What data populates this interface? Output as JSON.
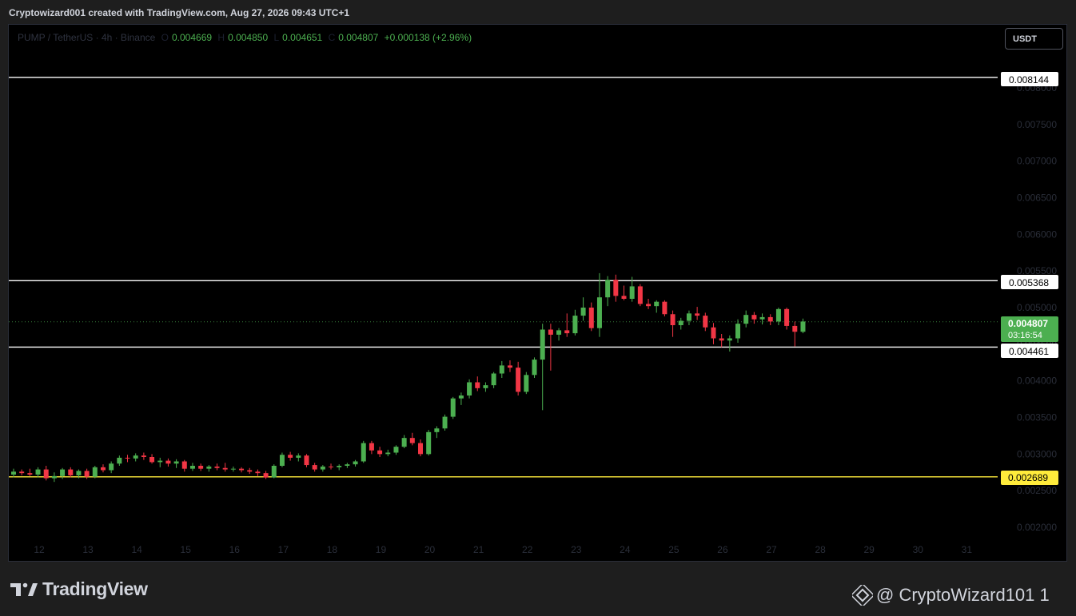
{
  "header": {
    "credit": "Cryptowizard001 created with TradingView.com, Aug 27, 2026 09:43 UTC+1"
  },
  "legend": {
    "symbol": "PUMP / TetherUS · 4h · Binance",
    "open": "0.004669",
    "high": "0.004850",
    "low": "0.004651",
    "close": "0.004807",
    "change": "+0.000138 (+2.96%)"
  },
  "currency_button": "USDT",
  "price_tags": {
    "resistance_top": "0.008144",
    "resistance_mid": "0.005368",
    "current_price": "0.004807",
    "countdown": "03:16:54",
    "support_mid": "0.004461",
    "support_low": "0.002689"
  },
  "footer": {
    "brand": "TradingView",
    "author": "@ CryptoWizard101 1"
  },
  "colors": {
    "up": "#4caf50",
    "down": "#f23645",
    "level_line": "#ffffff",
    "support_line": "#ffeb3b",
    "axis_text": "#2a2e39",
    "background": "#000000"
  },
  "chart_data": {
    "type": "candlestick",
    "title": "PUMP / TetherUS · 4h · Binance",
    "xlabel": "",
    "ylabel": "",
    "x_tick_labels": [
      "12",
      "13",
      "14",
      "15",
      "16",
      "17",
      "18",
      "19",
      "20",
      "21",
      "22",
      "23",
      "24",
      "25",
      "26",
      "27",
      "28",
      "29",
      "30",
      "31"
    ],
    "y_tick_labels": [
      "0.008000",
      "0.007500",
      "0.007000",
      "0.006500",
      "0.006000",
      "0.005500",
      "0.005000",
      "0.004500",
      "0.004000",
      "0.003500",
      "0.003000",
      "0.002500",
      "0.002000"
    ],
    "ylim": [
      0.00185,
      0.0088
    ],
    "horizontal_levels": [
      0.008144,
      0.005368,
      0.004461,
      0.002689
    ],
    "last_price": 0.004807,
    "grid": false,
    "candles": [
      {
        "o": 0.00272,
        "h": 0.0028,
        "l": 0.00268,
        "c": 0.00276
      },
      {
        "o": 0.00276,
        "h": 0.00279,
        "l": 0.00271,
        "c": 0.00274
      },
      {
        "o": 0.00274,
        "h": 0.0028,
        "l": 0.0027,
        "c": 0.00272
      },
      {
        "o": 0.00272,
        "h": 0.00282,
        "l": 0.00268,
        "c": 0.00279
      },
      {
        "o": 0.00279,
        "h": 0.00284,
        "l": 0.00264,
        "c": 0.00267
      },
      {
        "o": 0.00267,
        "h": 0.00275,
        "l": 0.00262,
        "c": 0.0027
      },
      {
        "o": 0.0027,
        "h": 0.00281,
        "l": 0.00266,
        "c": 0.00279
      },
      {
        "o": 0.00279,
        "h": 0.00282,
        "l": 0.00268,
        "c": 0.00271
      },
      {
        "o": 0.00271,
        "h": 0.00279,
        "l": 0.00267,
        "c": 0.00277
      },
      {
        "o": 0.00277,
        "h": 0.0028,
        "l": 0.00266,
        "c": 0.00269
      },
      {
        "o": 0.00269,
        "h": 0.00284,
        "l": 0.00267,
        "c": 0.00282
      },
      {
        "o": 0.00282,
        "h": 0.00286,
        "l": 0.00275,
        "c": 0.00278
      },
      {
        "o": 0.00278,
        "h": 0.0029,
        "l": 0.00274,
        "c": 0.00287
      },
      {
        "o": 0.00287,
        "h": 0.00298,
        "l": 0.00284,
        "c": 0.00295
      },
      {
        "o": 0.00295,
        "h": 0.00299,
        "l": 0.00289,
        "c": 0.00294
      },
      {
        "o": 0.00294,
        "h": 0.00301,
        "l": 0.0029,
        "c": 0.00298
      },
      {
        "o": 0.00298,
        "h": 0.00302,
        "l": 0.00292,
        "c": 0.00296
      },
      {
        "o": 0.00296,
        "h": 0.003,
        "l": 0.00287,
        "c": 0.00289
      },
      {
        "o": 0.00289,
        "h": 0.00295,
        "l": 0.00282,
        "c": 0.00291
      },
      {
        "o": 0.00291,
        "h": 0.00294,
        "l": 0.00283,
        "c": 0.00287
      },
      {
        "o": 0.00287,
        "h": 0.00293,
        "l": 0.00281,
        "c": 0.0029
      },
      {
        "o": 0.0029,
        "h": 0.00292,
        "l": 0.00276,
        "c": 0.0028
      },
      {
        "o": 0.0028,
        "h": 0.00288,
        "l": 0.00277,
        "c": 0.00284
      },
      {
        "o": 0.00284,
        "h": 0.00287,
        "l": 0.00277,
        "c": 0.0028
      },
      {
        "o": 0.0028,
        "h": 0.00285,
        "l": 0.00276,
        "c": 0.00283
      },
      {
        "o": 0.00283,
        "h": 0.00287,
        "l": 0.00278,
        "c": 0.00281
      },
      {
        "o": 0.00281,
        "h": 0.00288,
        "l": 0.00276,
        "c": 0.00279
      },
      {
        "o": 0.00279,
        "h": 0.00283,
        "l": 0.00276,
        "c": 0.0028
      },
      {
        "o": 0.0028,
        "h": 0.00282,
        "l": 0.00275,
        "c": 0.00278
      },
      {
        "o": 0.00278,
        "h": 0.00281,
        "l": 0.00273,
        "c": 0.00276
      },
      {
        "o": 0.00276,
        "h": 0.00279,
        "l": 0.0027,
        "c": 0.00274
      },
      {
        "o": 0.00274,
        "h": 0.00277,
        "l": 0.00266,
        "c": 0.00268
      },
      {
        "o": 0.00268,
        "h": 0.00286,
        "l": 0.00267,
        "c": 0.00284
      },
      {
        "o": 0.00284,
        "h": 0.00302,
        "l": 0.00282,
        "c": 0.00299
      },
      {
        "o": 0.00299,
        "h": 0.00303,
        "l": 0.00291,
        "c": 0.00295
      },
      {
        "o": 0.00295,
        "h": 0.00301,
        "l": 0.0029,
        "c": 0.00298
      },
      {
        "o": 0.00298,
        "h": 0.003,
        "l": 0.00282,
        "c": 0.00285
      },
      {
        "o": 0.00285,
        "h": 0.00288,
        "l": 0.00276,
        "c": 0.00279
      },
      {
        "o": 0.00279,
        "h": 0.00285,
        "l": 0.00276,
        "c": 0.00283
      },
      {
        "o": 0.00283,
        "h": 0.00287,
        "l": 0.00279,
        "c": 0.00282
      },
      {
        "o": 0.00282,
        "h": 0.00286,
        "l": 0.00278,
        "c": 0.00284
      },
      {
        "o": 0.00284,
        "h": 0.00288,
        "l": 0.00281,
        "c": 0.00286
      },
      {
        "o": 0.00286,
        "h": 0.00292,
        "l": 0.00283,
        "c": 0.0029
      },
      {
        "o": 0.0029,
        "h": 0.00318,
        "l": 0.00288,
        "c": 0.00315
      },
      {
        "o": 0.00315,
        "h": 0.00318,
        "l": 0.003,
        "c": 0.00305
      },
      {
        "o": 0.00305,
        "h": 0.0031,
        "l": 0.00296,
        "c": 0.003
      },
      {
        "o": 0.003,
        "h": 0.00306,
        "l": 0.00297,
        "c": 0.00302
      },
      {
        "o": 0.00302,
        "h": 0.00312,
        "l": 0.00299,
        "c": 0.0031
      },
      {
        "o": 0.0031,
        "h": 0.00326,
        "l": 0.00308,
        "c": 0.00322
      },
      {
        "o": 0.00322,
        "h": 0.00329,
        "l": 0.00312,
        "c": 0.00315
      },
      {
        "o": 0.00315,
        "h": 0.0032,
        "l": 0.00297,
        "c": 0.003
      },
      {
        "o": 0.003,
        "h": 0.00333,
        "l": 0.00298,
        "c": 0.0033
      },
      {
        "o": 0.0033,
        "h": 0.00338,
        "l": 0.00322,
        "c": 0.00335
      },
      {
        "o": 0.00335,
        "h": 0.00354,
        "l": 0.00332,
        "c": 0.00351
      },
      {
        "o": 0.00351,
        "h": 0.00378,
        "l": 0.00348,
        "c": 0.00376
      },
      {
        "o": 0.00376,
        "h": 0.00384,
        "l": 0.00367,
        "c": 0.0038
      },
      {
        "o": 0.0038,
        "h": 0.00402,
        "l": 0.00376,
        "c": 0.00398
      },
      {
        "o": 0.00398,
        "h": 0.00406,
        "l": 0.00386,
        "c": 0.0039
      },
      {
        "o": 0.0039,
        "h": 0.00398,
        "l": 0.00385,
        "c": 0.00394
      },
      {
        "o": 0.00394,
        "h": 0.00412,
        "l": 0.0039,
        "c": 0.0041
      },
      {
        "o": 0.0041,
        "h": 0.00427,
        "l": 0.00404,
        "c": 0.00421
      },
      {
        "o": 0.00421,
        "h": 0.00428,
        "l": 0.00412,
        "c": 0.00418
      },
      {
        "o": 0.00418,
        "h": 0.00426,
        "l": 0.0038,
        "c": 0.00385
      },
      {
        "o": 0.00385,
        "h": 0.00412,
        "l": 0.00382,
        "c": 0.00408
      },
      {
        "o": 0.00408,
        "h": 0.00432,
        "l": 0.00404,
        "c": 0.00429
      },
      {
        "o": 0.00429,
        "h": 0.00478,
        "l": 0.0036,
        "c": 0.0047
      },
      {
        "o": 0.0047,
        "h": 0.00478,
        "l": 0.00414,
        "c": 0.00463
      },
      {
        "o": 0.00463,
        "h": 0.00472,
        "l": 0.00455,
        "c": 0.00469
      },
      {
        "o": 0.00469,
        "h": 0.00492,
        "l": 0.0046,
        "c": 0.00465
      },
      {
        "o": 0.00465,
        "h": 0.00497,
        "l": 0.00462,
        "c": 0.00489
      },
      {
        "o": 0.00489,
        "h": 0.00514,
        "l": 0.00482,
        "c": 0.005
      },
      {
        "o": 0.005,
        "h": 0.00507,
        "l": 0.00468,
        "c": 0.00472
      },
      {
        "o": 0.00472,
        "h": 0.00547,
        "l": 0.0046,
        "c": 0.00514
      },
      {
        "o": 0.00514,
        "h": 0.00543,
        "l": 0.00502,
        "c": 0.00538
      },
      {
        "o": 0.00538,
        "h": 0.00545,
        "l": 0.00508,
        "c": 0.00516
      },
      {
        "o": 0.00516,
        "h": 0.0053,
        "l": 0.0051,
        "c": 0.00512
      },
      {
        "o": 0.00512,
        "h": 0.00542,
        "l": 0.00508,
        "c": 0.00529
      },
      {
        "o": 0.00529,
        "h": 0.00532,
        "l": 0.00502,
        "c": 0.00505
      },
      {
        "o": 0.00505,
        "h": 0.00512,
        "l": 0.00498,
        "c": 0.00502
      },
      {
        "o": 0.00502,
        "h": 0.0051,
        "l": 0.00493,
        "c": 0.00508
      },
      {
        "o": 0.00508,
        "h": 0.0051,
        "l": 0.00488,
        "c": 0.00491
      },
      {
        "o": 0.00491,
        "h": 0.00496,
        "l": 0.0046,
        "c": 0.00476
      },
      {
        "o": 0.00476,
        "h": 0.00486,
        "l": 0.0047,
        "c": 0.00482
      },
      {
        "o": 0.00482,
        "h": 0.00496,
        "l": 0.00476,
        "c": 0.00492
      },
      {
        "o": 0.00492,
        "h": 0.00501,
        "l": 0.00483,
        "c": 0.00489
      },
      {
        "o": 0.00489,
        "h": 0.00493,
        "l": 0.00468,
        "c": 0.00473
      },
      {
        "o": 0.00473,
        "h": 0.00479,
        "l": 0.0045,
        "c": 0.00458
      },
      {
        "o": 0.00458,
        "h": 0.00464,
        "l": 0.00446,
        "c": 0.00455
      },
      {
        "o": 0.00455,
        "h": 0.00462,
        "l": 0.0044,
        "c": 0.00458
      },
      {
        "o": 0.00458,
        "h": 0.00484,
        "l": 0.00452,
        "c": 0.00478
      },
      {
        "o": 0.00478,
        "h": 0.00496,
        "l": 0.00473,
        "c": 0.0049
      },
      {
        "o": 0.0049,
        "h": 0.00494,
        "l": 0.00478,
        "c": 0.00484
      },
      {
        "o": 0.00484,
        "h": 0.00492,
        "l": 0.00477,
        "c": 0.00487
      },
      {
        "o": 0.00487,
        "h": 0.00491,
        "l": 0.00476,
        "c": 0.00481
      },
      {
        "o": 0.00481,
        "h": 0.005,
        "l": 0.00476,
        "c": 0.00498
      },
      {
        "o": 0.00498,
        "h": 0.005,
        "l": 0.0047,
        "c": 0.00475
      },
      {
        "o": 0.00475,
        "h": 0.00481,
        "l": 0.00447,
        "c": 0.00467
      },
      {
        "o": 0.00467,
        "h": 0.00485,
        "l": 0.00465,
        "c": 0.00481
      }
    ]
  }
}
